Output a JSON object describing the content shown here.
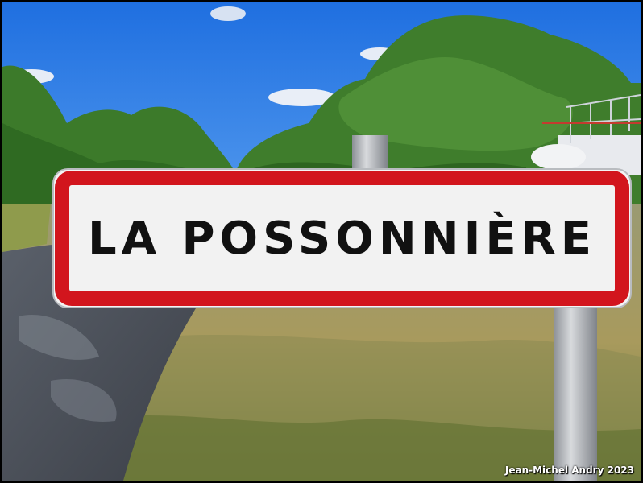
{
  "sign": {
    "name": "LA POSSONNIÈRE",
    "text_color": "#111111",
    "border_color": "#d2151d",
    "background_color": "#f2f2f2"
  },
  "credit": {
    "text": "Jean-Michel Andry 2023"
  },
  "scene": {
    "sky_color": "#2f79e6",
    "foliage_color": "#3f7d2c",
    "grass_color": "#a89a5d",
    "road_color": "#4a4f57"
  }
}
